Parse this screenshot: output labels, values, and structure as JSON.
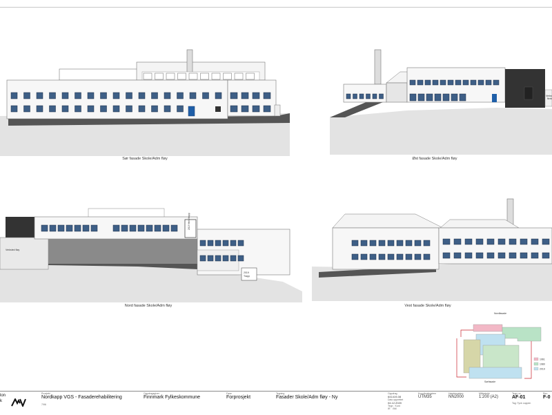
{
  "elevations": [
    {
      "id": "south",
      "caption": "Sør fasade Skole/Adm fløy"
    },
    {
      "id": "east",
      "caption": "Øst fasade Skole/Adm fløy"
    },
    {
      "id": "north",
      "caption": "Nord fasade Skole/Adm fløy"
    },
    {
      "id": "west",
      "caption": "Vest fasade Skole/Adm fløy"
    }
  ],
  "annotations": {
    "verksted_east": "Verksted flerb",
    "verksted_north": "Verksted fløy",
    "stair_north": "2019 Trapp",
    "stair_north_upper": "2019 Heis/trapp"
  },
  "keyplan": {
    "north_label": "Nordfasade",
    "south_label": "Sørfasade",
    "legend": [
      "1961",
      "1980",
      "2019"
    ],
    "legend_colors": [
      "#f2b8c6",
      "#b9e3c6",
      "#bfe1f0"
    ]
  },
  "titleblock": {
    "company_partial": "lon\nk",
    "project_label": "Prosjekt",
    "project": "Nordkapp VGS - Fasaderehabilitering",
    "project_sub": "7/96",
    "client_label": "Oppdragsgiver",
    "client": "Finnmark Fylkeskommune",
    "phase_label": "Fase",
    "phase": "Forprosjekt",
    "drawing_label": "Tegning",
    "drawing": "Fasader Skole/Adm fløy - Ny",
    "assignment_label": "Oppdrag",
    "assignment": "641419-08",
    "date_label": "Dato opprettet",
    "date": "04.12.2020",
    "drawn_label": "Tegn",
    "drawn": "IR",
    "checked_label": "Kont",
    "checked": "BM",
    "coord_label": "Koordinatsystem",
    "coord": "UTM35",
    "height_label": "Høydesystem",
    "height": "NN2000",
    "scale_label": "Målestokk",
    "scale": "1:200 (A2)",
    "sheet_label": "Tegn. nr.",
    "sheet": "AF-01",
    "drawn_by": "Tag: Tyvk Lappen",
    "revision_label": "Rev.",
    "revision": "F-0"
  }
}
